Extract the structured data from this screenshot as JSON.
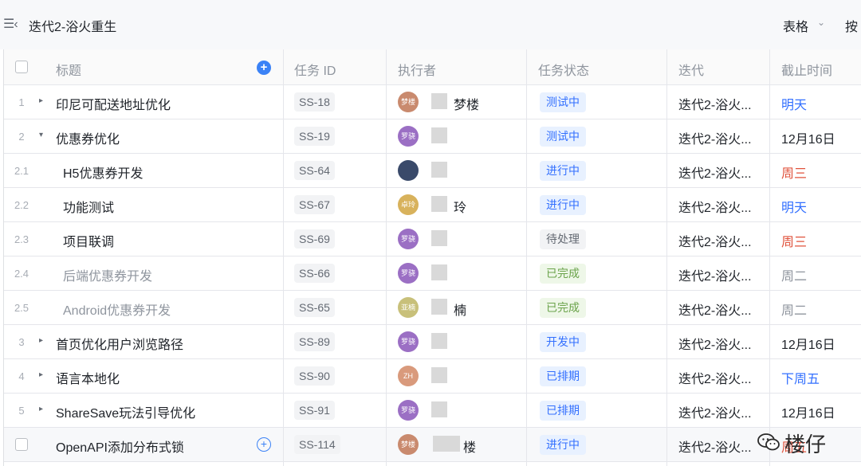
{
  "topbar": {
    "collapse_glyph": "☰‹",
    "title": "迭代2-浴火重生",
    "view_label": "表格",
    "view_chevron": "⌄",
    "sort_label": "按"
  },
  "columns": {
    "title": "标题",
    "task_id": "任务 ID",
    "owner": "执行者",
    "status": "任务状态",
    "iteration": "迭代",
    "due": "截止时间"
  },
  "colors": {
    "accent": "#3370ff",
    "due_blue": "#3370ff",
    "due_red": "#e0533d",
    "due_grey": "#8f959e",
    "due_black": "#1f2329"
  },
  "rows": [
    {
      "num": "1",
      "arrow": "▸",
      "title": "印尼可配送地址优化",
      "task_id": "SS-18",
      "avatar_text": "梦楼",
      "avatar_color": "#c98a6e",
      "owner": "梦楼",
      "status": "测试中",
      "status_style": "blue",
      "iteration": "迭代2-浴火...",
      "due": "明天",
      "due_color": "blue",
      "indent": 0,
      "done": false
    },
    {
      "num": "2",
      "arrow": "▾",
      "title": "优惠券优化",
      "task_id": "SS-19",
      "avatar_text": "罗骁",
      "avatar_color": "#9b6fc4",
      "owner": "",
      "status": "测试中",
      "status_style": "blue",
      "iteration": "迭代2-浴火...",
      "due": "12月16日",
      "due_color": "black",
      "indent": 0,
      "done": false
    },
    {
      "num": "2.1",
      "arrow": "",
      "title": "H5优惠券开发",
      "task_id": "SS-64",
      "avatar_text": "",
      "avatar_color": "#3a4a6a",
      "owner": "",
      "status": "进行中",
      "status_style": "blue",
      "iteration": "迭代2-浴火...",
      "due": "周三",
      "due_color": "red",
      "indent": 1,
      "done": false
    },
    {
      "num": "2.2",
      "arrow": "",
      "title": "功能测试",
      "task_id": "SS-67",
      "avatar_text": "卓玲",
      "avatar_color": "#d8b25c",
      "owner": "玲",
      "status": "进行中",
      "status_style": "blue",
      "iteration": "迭代2-浴火...",
      "due": "明天",
      "due_color": "blue",
      "indent": 1,
      "done": false
    },
    {
      "num": "2.3",
      "arrow": "",
      "title": "项目联调",
      "task_id": "SS-69",
      "avatar_text": "罗骁",
      "avatar_color": "#9b6fc4",
      "owner": "",
      "status": "待处理",
      "status_style": "grey",
      "iteration": "迭代2-浴火...",
      "due": "周三",
      "due_color": "red",
      "indent": 1,
      "done": false
    },
    {
      "num": "2.4",
      "arrow": "",
      "title": "后端优惠券开发",
      "task_id": "SS-66",
      "avatar_text": "罗骁",
      "avatar_color": "#9b6fc4",
      "owner": "",
      "status": "已完成",
      "status_style": "green",
      "iteration": "迭代2-浴火...",
      "due": "周二",
      "due_color": "grey",
      "indent": 1,
      "done": true
    },
    {
      "num": "2.5",
      "arrow": "",
      "title": "Android优惠券开发",
      "task_id": "SS-65",
      "avatar_text": "亚楠",
      "avatar_color": "#c8c07a",
      "owner": "楠",
      "status": "已完成",
      "status_style": "green",
      "iteration": "迭代2-浴火...",
      "due": "周二",
      "due_color": "grey",
      "indent": 1,
      "done": true
    },
    {
      "num": "3",
      "arrow": "▸",
      "title": "首页优化用户浏览路径",
      "task_id": "SS-89",
      "avatar_text": "罗骁",
      "avatar_color": "#9b6fc4",
      "owner": "",
      "status": "开发中",
      "status_style": "blue",
      "iteration": "迭代2-浴火...",
      "due": "12月16日",
      "due_color": "black",
      "indent": 0,
      "done": false
    },
    {
      "num": "4",
      "arrow": "▸",
      "title": "语言本地化",
      "task_id": "SS-90",
      "avatar_text": "ZH",
      "avatar_color": "#d99a7c",
      "owner": "",
      "status": "已排期",
      "status_style": "blue",
      "iteration": "迭代2-浴火...",
      "due": "下周五",
      "due_color": "blue",
      "indent": 0,
      "done": false
    },
    {
      "num": "5",
      "arrow": "▸",
      "title": "ShareSave玩法引导优化",
      "task_id": "SS-91",
      "avatar_text": "罗骁",
      "avatar_color": "#9b6fc4",
      "owner": "",
      "status": "已排期",
      "status_style": "blue",
      "iteration": "迭代2-浴火...",
      "due": "12月16日",
      "due_color": "black",
      "indent": 0,
      "done": false
    }
  ],
  "last_row": {
    "title": "OpenAPI添加分布式锁",
    "task_id": "SS-114",
    "avatar_text": "梦楼",
    "avatar_color": "#c98a6e",
    "owner": "楼",
    "status": "进行中",
    "status_style": "blue",
    "iteration": "迭代2-浴火...",
    "due": "周五",
    "due_color": "red"
  },
  "watermark": {
    "icon": "wechat-icon",
    "text": "楼仔"
  }
}
